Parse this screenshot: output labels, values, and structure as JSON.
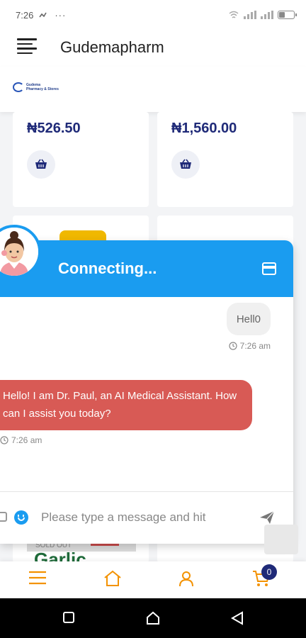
{
  "status_bar": {
    "time": "7:26",
    "icons": [
      "missed-call-icon",
      "more-dots-icon",
      "wifi-icon",
      "signal-icon",
      "battery-icon"
    ]
  },
  "app_bar": {
    "title": "Gudemapharm",
    "menu_icon": "hamburger-icon"
  },
  "logo": {
    "line1": "Gudema",
    "line2": "Pharmacy & Stores"
  },
  "products": [
    {
      "price": "₦526.50",
      "action_icon": "basket-icon"
    },
    {
      "price": "₦1,560.00",
      "action_icon": "basket-icon"
    }
  ],
  "bottom_product": {
    "badge": "SOLD OUT",
    "name": "Garlic"
  },
  "chat": {
    "status": "Connecting...",
    "messages": [
      {
        "from": "user",
        "text": "Hell0",
        "time": "7:26 am"
      },
      {
        "from": "bot",
        "text": "Hello! I am Dr. Paul, an AI Medical Assistant. How can I assist you today?",
        "time": "7:26 am"
      }
    ],
    "input_placeholder": "Please type a message and hit",
    "colors": {
      "header": "#1a9cf0",
      "bot_bubble": "#d85a55",
      "user_bubble": "#f0f0f0"
    }
  },
  "bottom_nav": {
    "items": [
      "menu-icon",
      "home-icon",
      "account-icon",
      "cart-icon"
    ],
    "cart_count": "0",
    "accent": "#f39200"
  },
  "colors": {
    "brand_dark": "#1f2a78",
    "accent_orange": "#f39200"
  }
}
